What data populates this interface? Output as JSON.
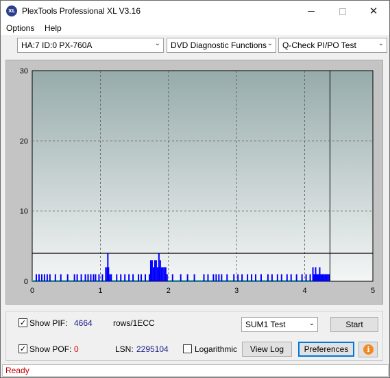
{
  "window": {
    "title": "PlexTools Professional XL V3.16",
    "icon_text": "XL"
  },
  "menu": {
    "options": "Options",
    "help": "Help"
  },
  "toolbar": {
    "drive": "HA:7 ID:0  PX-760A",
    "function": "DVD Diagnostic Functions",
    "test": "Q-Check PI/PO Test"
  },
  "chart_data": {
    "type": "bar",
    "xlim": [
      0,
      5
    ],
    "ylim": [
      0,
      30
    ],
    "x_ticks": [
      "0",
      "1",
      "2",
      "3",
      "4",
      "5"
    ],
    "y_ticks": [
      "0",
      "10",
      "20",
      "30"
    ],
    "threshold_line": 4,
    "marker_x": 4.37,
    "grid": true,
    "colors": {
      "bars": "#0000ff",
      "po_line": "#00c8c8",
      "threshold": "#000000",
      "marker": "#000000"
    },
    "series": [
      {
        "x": [
          0.06,
          0.1,
          0.14,
          0.18,
          0.22,
          0.26,
          0.34,
          0.42,
          0.52,
          0.62,
          0.66,
          0.72,
          0.78,
          0.82,
          0.86,
          0.9,
          0.93,
          0.98,
          1.03,
          1.08,
          1.1,
          1.11,
          1.12,
          1.14,
          1.16,
          1.24,
          1.3,
          1.36,
          1.42,
          1.48,
          1.56,
          1.6,
          1.66,
          1.72,
          1.74,
          1.75,
          1.76,
          1.78,
          1.8,
          1.82,
          1.84,
          1.86,
          1.87,
          1.88,
          1.9,
          1.92,
          1.94,
          1.96,
          1.98,
          2.06,
          2.18,
          2.28,
          2.38,
          2.52,
          2.58,
          2.66,
          2.7,
          2.74,
          2.78,
          2.86,
          2.96,
          3.02,
          3.08,
          3.16,
          3.22,
          3.28,
          3.36,
          3.46,
          3.52,
          3.6,
          3.66,
          3.74,
          3.8,
          3.88,
          3.96,
          4.02,
          4.08,
          4.12,
          4.14,
          4.16,
          4.18,
          4.2,
          4.22,
          4.24,
          4.26,
          4.28,
          4.3,
          4.32,
          4.34,
          4.36
        ],
        "values": [
          1,
          1,
          1,
          1,
          1,
          1,
          1,
          1,
          1,
          1,
          1,
          1,
          1,
          1,
          1,
          1,
          1,
          1,
          1,
          2,
          2,
          4,
          2,
          1,
          1,
          1,
          1,
          1,
          1,
          1,
          1,
          1,
          1,
          1,
          3,
          2,
          3,
          2,
          3,
          3,
          2,
          4,
          2,
          3,
          2,
          2,
          2,
          2,
          1,
          1,
          1,
          1,
          1,
          1,
          1,
          1,
          1,
          1,
          1,
          1,
          1,
          1,
          1,
          1,
          1,
          1,
          1,
          1,
          1,
          1,
          1,
          1,
          1,
          1,
          1,
          1,
          1,
          2,
          1,
          2,
          1,
          1,
          2,
          1,
          1,
          1,
          1,
          1,
          1,
          1
        ]
      }
    ]
  },
  "controls": {
    "show_pif_label": "Show PIF:",
    "pif_value": "4664",
    "pif_unit": "rows/1ECC",
    "show_pof_label": "Show POF:",
    "pof_value": "0",
    "lsn_label": "LSN:",
    "lsn_value": "2295104",
    "logarithmic_label": "Logarithmic",
    "sum_select": "SUM1 Test",
    "start_button": "Start",
    "view_log_button": "View Log",
    "preferences_button": "Preferences",
    "info_icon_text": "i"
  },
  "status": {
    "text": "Ready"
  }
}
